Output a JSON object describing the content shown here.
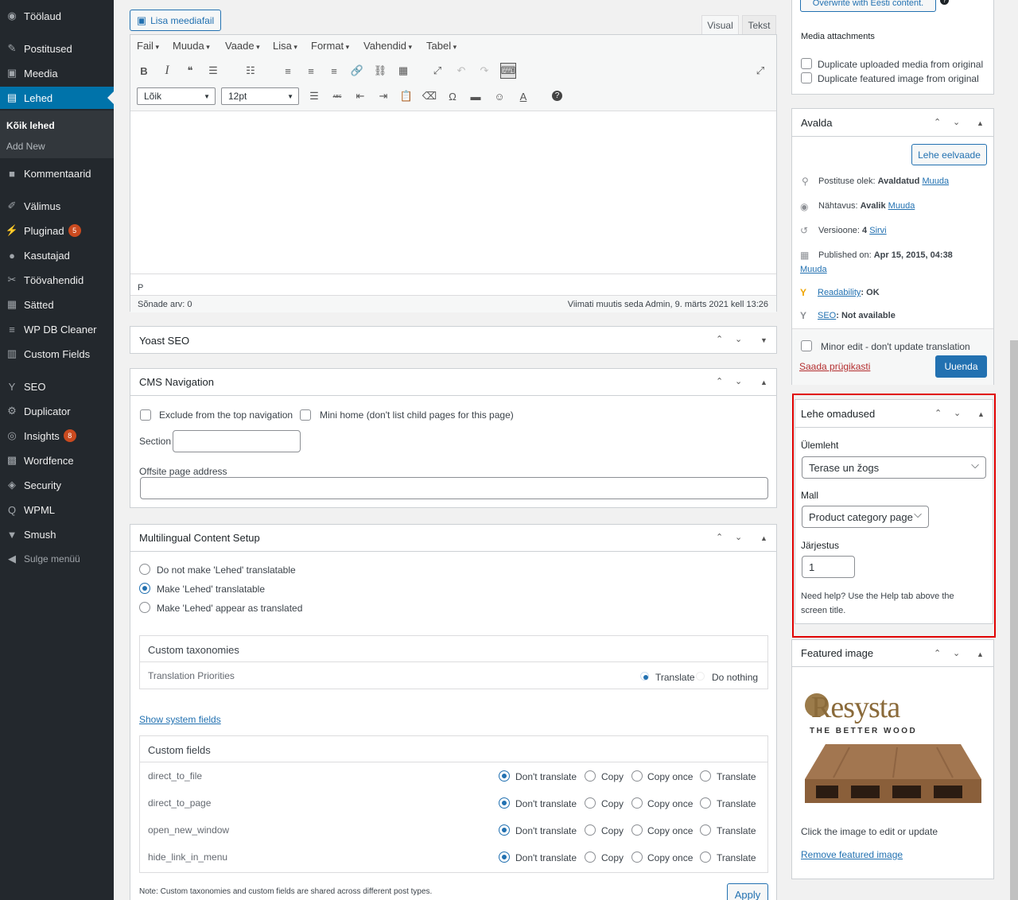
{
  "sidebar": {
    "items": [
      {
        "label": "Töölaud",
        "icon": "dashboard-icon",
        "glyph": "◉"
      },
      {
        "label": "Postitused",
        "icon": "pin-icon",
        "glyph": "✎"
      },
      {
        "label": "Meedia",
        "icon": "media-icon",
        "glyph": "▣"
      },
      {
        "label": "Lehed",
        "icon": "page-icon",
        "glyph": "▤"
      },
      {
        "label": "Kommentaarid",
        "icon": "comment-icon",
        "glyph": "■"
      },
      {
        "label": "Välimus",
        "icon": "brush-icon",
        "glyph": "✐"
      },
      {
        "label": "Pluginad",
        "icon": "plugin-icon",
        "glyph": "⚡",
        "badge": "5"
      },
      {
        "label": "Kasutajad",
        "icon": "users-icon",
        "glyph": "●"
      },
      {
        "label": "Töövahendid",
        "icon": "wrench-icon",
        "glyph": "✂"
      },
      {
        "label": "Sätted",
        "icon": "settings-icon",
        "glyph": "▦"
      },
      {
        "label": "WP DB Cleaner",
        "icon": "database-icon",
        "glyph": "≡"
      },
      {
        "label": "Custom Fields",
        "icon": "fields-icon",
        "glyph": "▥"
      },
      {
        "label": "SEO",
        "icon": "yoast-icon",
        "glyph": "Y"
      },
      {
        "label": "Duplicator",
        "icon": "duplicator-icon",
        "glyph": "⚙"
      },
      {
        "label": "Insights",
        "icon": "insights-icon",
        "glyph": "◎",
        "badge": "8"
      },
      {
        "label": "Wordfence",
        "icon": "wordfence-icon",
        "glyph": "▩"
      },
      {
        "label": "Security",
        "icon": "shield-icon",
        "glyph": "◈"
      },
      {
        "label": "WPML",
        "icon": "wpml-icon",
        "glyph": "Q"
      },
      {
        "label": "Smush",
        "icon": "smush-icon",
        "glyph": "▼"
      },
      {
        "label": "Sulge menüü",
        "icon": "collapse-icon",
        "glyph": "◀"
      }
    ],
    "submenu": {
      "current": "Kõik lehed",
      "add": "Add New"
    }
  },
  "editor": {
    "add_media": "Lisa meediafail",
    "tab_visual": "Visual",
    "tab_text": "Tekst",
    "menus": [
      "Fail",
      "Muuda",
      "Vaade",
      "Lisa",
      "Format",
      "Vahendid",
      "Tabel"
    ],
    "format_select": "Lõik",
    "size_select": "12pt",
    "path": "P",
    "word_count": "Sõnade arv: 0",
    "last_edit": "Viimati muutis seda Admin, 9. märts 2021 kell 13:26"
  },
  "yoast": {
    "title": "Yoast SEO"
  },
  "cms_nav": {
    "title": "CMS Navigation",
    "exclude": "Exclude from the top navigation",
    "mini_home": "Mini home (don't list child pages for this page)",
    "section": "Section",
    "offsite": "Offsite page address"
  },
  "multilingual": {
    "title": "Multilingual Content Setup",
    "options": [
      "Do not make 'Lehed' translatable",
      "Make 'Lehed' translatable",
      "Make 'Lehed' appear as translated"
    ],
    "taxonomies": "Custom taxonomies",
    "priorities": "Translation Priorities",
    "translate": "Translate",
    "do_nothing": "Do nothing",
    "show_system": "Show system fields",
    "custom_fields": "Custom fields",
    "fields": [
      "direct_to_file",
      "direct_to_page",
      "open_new_window",
      "hide_link_in_menu"
    ],
    "field_options": [
      "Don't translate",
      "Copy",
      "Copy once",
      "Translate"
    ],
    "note": "Note: Custom taxonomies and custom fields are shared across different post types.",
    "apply": "Apply"
  },
  "right_top": {
    "overwrite": "Overwrite with Eesti content.",
    "media_attachments": "Media attachments",
    "dup_media": "Duplicate uploaded media from original",
    "dup_featured": "Duplicate featured image from original"
  },
  "publish": {
    "title": "Avalda",
    "preview": "Lehe eelvaade",
    "status_label": "Postituse olek:",
    "status_value": "Avaldatud",
    "visibility_label": "Nähtavus:",
    "visibility_value": "Avalik",
    "revisions_label": "Versioone:",
    "revisions_value": "4",
    "browse": "Sirvi",
    "published_label": "Published on:",
    "published_value": "Apr 15, 2015, 04:38",
    "edit": "Muuda",
    "readability": "Readability",
    "readability_value": ": OK",
    "seo": "SEO",
    "seo_value": ": Not available",
    "minor_edit": "Minor edit - don't update translation",
    "trash": "Saada prügikasti",
    "update": "Uuenda"
  },
  "attributes": {
    "title": "Lehe omadused",
    "parent_label": "Ülemleht",
    "parent_value": "Terase un žogs",
    "template_label": "Mall",
    "template_value": "Product category page",
    "order_label": "Järjestus",
    "order_value": "1",
    "help": "Need help? Use the Help tab above the screen title.",
    "highlight_color": "#e00000"
  },
  "featured": {
    "title": "Featured image",
    "logo_text": "Resysta",
    "logo_tagline": "THE BETTER WOOD",
    "hint": "Click the image to edit or update",
    "remove": "Remove featured image"
  }
}
